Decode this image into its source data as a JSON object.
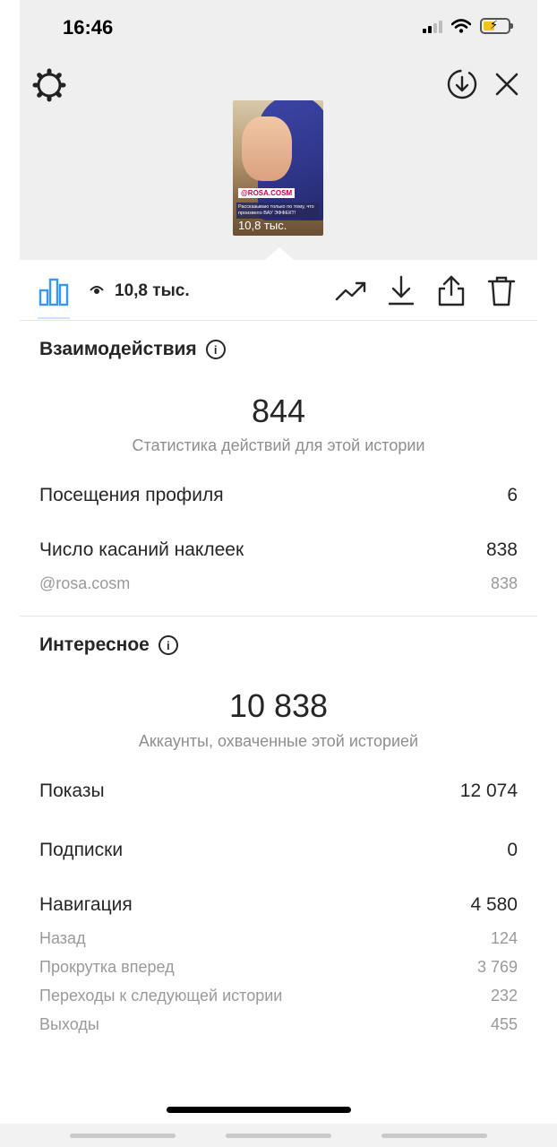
{
  "status_bar": {
    "time": "16:46"
  },
  "story": {
    "thumbnail_tag": "@ROSA.COSM",
    "thumbnail_text": "Рассказываю только по тому, что произвело ВАУ ЭФФЕКТ!",
    "thumbnail_views": "10,8 тыс."
  },
  "toolbar": {
    "views": "10,8 тыс."
  },
  "interactions": {
    "title": "Взаимодействия",
    "total": "844",
    "caption": "Статистика действий для этой истории",
    "rows": [
      {
        "label": "Посещения профиля",
        "value": "6"
      },
      {
        "label": "Число касаний наклеек",
        "value": "838"
      }
    ],
    "sub_rows": [
      {
        "label": "@rosa.cosm",
        "value": "838"
      }
    ]
  },
  "discovery": {
    "title": "Интересное",
    "total": "10 838",
    "caption": "Аккаунты, охваченные этой историей",
    "rows": [
      {
        "label": "Показы",
        "value": "12 074"
      },
      {
        "label": "Подписки",
        "value": "0"
      },
      {
        "label": "Навигация",
        "value": "4 580"
      }
    ],
    "navigation_details": [
      {
        "label": "Назад",
        "value": "124"
      },
      {
        "label": "Прокрутка вперед",
        "value": "3 769"
      },
      {
        "label": "Переходы к следующей истории",
        "value": "232"
      },
      {
        "label": "Выходы",
        "value": "455"
      }
    ]
  },
  "icons": {
    "settings": "gear-icon",
    "download_circle": "download-circle-icon",
    "close": "close-icon",
    "stats": "bar-chart-icon",
    "eye": "eye-icon",
    "trend": "trending-up-icon",
    "download": "download-icon",
    "share": "share-icon",
    "delete": "trash-icon"
  },
  "colors": {
    "accent": "#3897f0",
    "muted": "#8e8e8e",
    "battery": "#f4c318"
  }
}
